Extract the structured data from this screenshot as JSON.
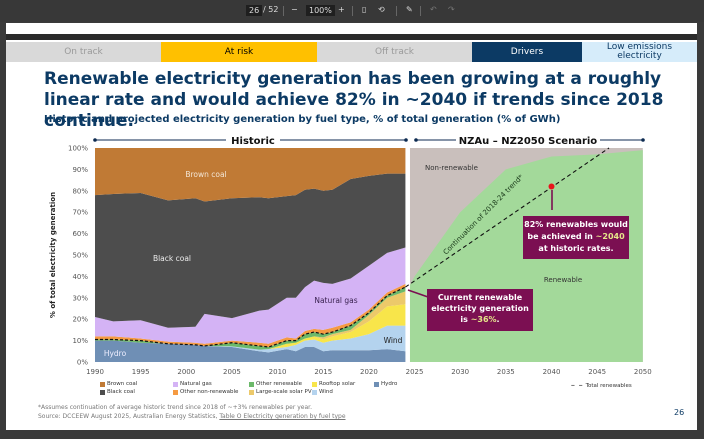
{
  "viewer": {
    "page_current": "26",
    "page_total": "/ 52",
    "zoom": "100%",
    "minus": "−",
    "plus": "+"
  },
  "tabs": [
    {
      "label": "On track",
      "bg": "#d9d9d9",
      "color": "#9a9a9a"
    },
    {
      "label": "At risk",
      "bg": "#ffc000",
      "color": "#000000"
    },
    {
      "label": "Off track",
      "bg": "#d9d9d9",
      "color": "#9a9a9a"
    },
    {
      "label": "Drivers",
      "bg": "#0c3a64",
      "color": "#ffffff"
    },
    {
      "label": "Low emissions electricity",
      "bg": "#d6ecfa",
      "color": "#0c3a64"
    }
  ],
  "title": "Renewable electricity generation has been growing at a roughly linear rate and would achieve 82% in ~2040 if trends since 2018 continue.",
  "subtitle": "Historic and projected electricity generation by fuel type, % of total generation (% of GWh)",
  "chart_data": {
    "type": "area",
    "ylabel": "% of total electricity generation",
    "ylim": [
      0,
      100
    ],
    "xlim": [
      1990,
      2050
    ],
    "yticks": [
      "0%",
      "10%",
      "20%",
      "30%",
      "40%",
      "50%",
      "60%",
      "70%",
      "80%",
      "90%",
      "100%"
    ],
    "xticks": [
      "1990",
      "1995",
      "2000",
      "2005",
      "2010",
      "2015",
      "2020",
      "2025",
      "2030",
      "2035",
      "2040",
      "2045",
      "2050"
    ],
    "section_labels": {
      "historic": "Historic",
      "scenario": "NZAu – NZ2050 Scenario"
    },
    "years": [
      1990,
      1992,
      1995,
      1998,
      2001,
      2002,
      2005,
      2008,
      2009,
      2011,
      2012,
      2013,
      2014,
      2015,
      2016,
      2018,
      2020,
      2022,
      2024
    ],
    "series": [
      {
        "name": "Hydro",
        "color": "#6f8fb5",
        "values": [
          10,
          10,
          9,
          8.5,
          8,
          7.5,
          7,
          5,
          4.5,
          6,
          5,
          7,
          7,
          5,
          5.5,
          5.5,
          5.5,
          6,
          5
        ]
      },
      {
        "name": "Wind",
        "color": "#b4d3ee",
        "values": [
          0,
          0,
          0,
          0,
          0,
          0,
          0.3,
          0.8,
          1.5,
          1,
          3,
          3,
          3.5,
          4,
          4.5,
          5.5,
          7.5,
          11,
          12
        ]
      },
      {
        "name": "Rooftop solar",
        "color": "#f8e54a",
        "values": [
          0,
          0,
          0,
          0,
          0,
          0,
          0,
          0,
          0,
          1.5,
          1,
          1,
          1.5,
          1.5,
          2,
          3,
          6,
          9,
          10
        ]
      },
      {
        "name": "Large-scale solar PV",
        "color": "#ecc96a",
        "values": [
          0,
          0,
          0,
          0,
          0,
          0,
          0,
          0,
          0,
          0,
          0,
          0,
          0,
          1,
          1,
          1,
          3,
          4,
          6
        ]
      },
      {
        "name": "Other renewable",
        "color": "#6cb96a",
        "values": [
          0.5,
          0.5,
          1,
          0,
          0,
          0,
          1.7,
          1.7,
          1,
          1.5,
          1,
          2,
          2,
          1.5,
          1,
          2,
          1,
          1,
          2
        ]
      },
      {
        "name": "Other non-renewable",
        "color": "#f59a42",
        "values": [
          1.5,
          1.5,
          1,
          1,
          1,
          1,
          1,
          1.5,
          1.5,
          1.5,
          1,
          1.5,
          1.5,
          2,
          2,
          1.5,
          1.5,
          1.5,
          1.5
        ]
      },
      {
        "name": "Natural gas",
        "color": "#d4b3f5",
        "values": [
          9,
          7,
          8.5,
          6.5,
          7.5,
          14,
          10.5,
          15,
          16,
          18.5,
          19,
          20.5,
          22.5,
          22,
          20.5,
          20.5,
          20.5,
          18.5,
          17
        ]
      },
      {
        "name": "Black coal",
        "color": "#4d4d4d",
        "values": [
          57,
          59.5,
          59.5,
          59.5,
          60,
          52.5,
          56,
          53,
          52,
          47.5,
          48,
          45.5,
          43,
          43,
          44,
          46.5,
          42,
          37,
          34.5
        ]
      },
      {
        "name": "Brown coal",
        "color": "#c07a35",
        "values": [
          22,
          21.5,
          21,
          24.5,
          23.5,
          25,
          23.5,
          23,
          23.5,
          22.5,
          22,
          19.5,
          19,
          20,
          19.5,
          14.5,
          13,
          12,
          12
        ]
      }
    ],
    "scenario": {
      "years": [
        2024,
        2025,
        2030,
        2035,
        2040,
        2045,
        2050
      ],
      "renewable": [
        36,
        40,
        70,
        90,
        96,
        97,
        99
      ],
      "renewable_color": "#a3d99a",
      "nonrenewable_color": "#c9bfbc",
      "renewable_label": "Renewable",
      "nonrenewable_label": "Non-renewable"
    },
    "trend": {
      "label": "Continuation of 2018-24 trend*",
      "from": [
        2024,
        35
      ],
      "to": [
        2046.3,
        100
      ],
      "point": [
        2040,
        82
      ]
    },
    "area_labels": {
      "brown": "Brown coal",
      "black": "Black coal",
      "gas": "Natural gas",
      "wind": "Wind",
      "hydro": "Hydro"
    },
    "total_renewables_label": "Total renewables",
    "legend": [
      "Brown coal",
      "Black coal",
      "Natural gas",
      "Other non-renewable",
      "Other renewable",
      "Large-scale solar PV",
      "Rooftop solar",
      "Wind",
      "Hydro"
    ]
  },
  "callouts": {
    "current": {
      "pre": "Current renewable electricity generation is ",
      "value": "~36%",
      "post": "."
    },
    "future": {
      "pre": "82% renewables would be achieved in ",
      "value": "~2040",
      "post": " at historic rates."
    },
    "bg": "#7b0f52",
    "highlight": "#e6e58a"
  },
  "footnote": "*Assumes continuation of average historic trend since 2018 of ~+3% renewables per year.",
  "source_prefix": "Source: DCCEEW August 2025, Australian Energy Statistics, ",
  "source_link": "Table O Electricity generation by fuel type",
  "page_number": "26"
}
